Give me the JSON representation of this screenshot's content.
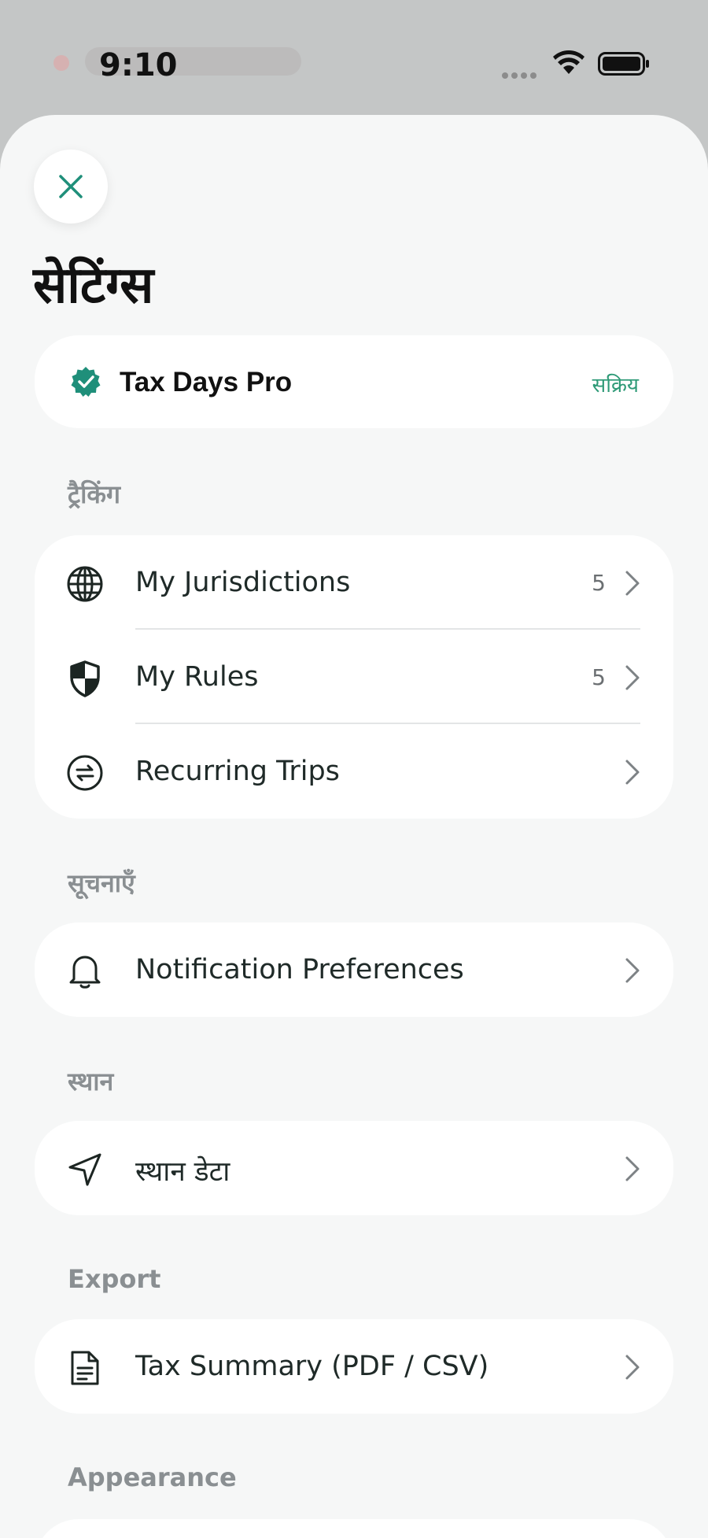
{
  "status_bar": {
    "time": "9:10"
  },
  "sheet": {
    "title": "सेटिंग्स",
    "pro": {
      "name": "Tax Days Pro",
      "status": "सक्रिय"
    },
    "sections": {
      "tracking": {
        "label": "ट्रैकिंग",
        "rows": [
          {
            "label": "My Jurisdictions",
            "count": "5",
            "icon": "globe-icon"
          },
          {
            "label": "My Rules",
            "count": "5",
            "icon": "shield-icon"
          },
          {
            "label": "Recurring Trips",
            "count": "",
            "icon": "repeat-icon"
          }
        ]
      },
      "notifications": {
        "label": "सूचनाएँ",
        "rows": [
          {
            "label": "Notification Preferences",
            "icon": "bell-icon"
          }
        ]
      },
      "location": {
        "label": "स्थान",
        "rows": [
          {
            "label": "स्थान डेटा",
            "icon": "location-arrow-icon"
          }
        ]
      },
      "export": {
        "label": "Export",
        "rows": [
          {
            "label": "Tax Summary (PDF / CSV)",
            "icon": "document-icon"
          }
        ]
      },
      "appearance": {
        "label": "Appearance"
      }
    }
  },
  "colors": {
    "accent": "#1f8f7a",
    "status_green": "#2e9a77",
    "section_label": "#8a8f92"
  }
}
